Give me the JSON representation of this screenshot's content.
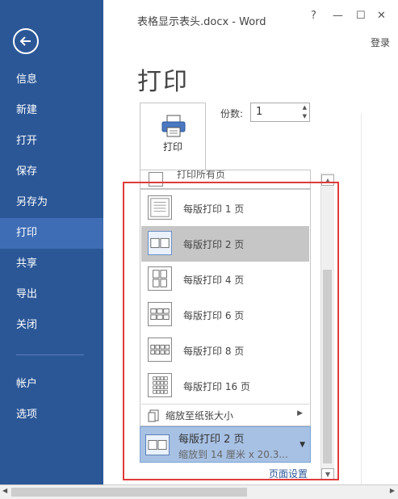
{
  "window": {
    "title": "表格显示表头.docx - Word",
    "help_label": "?",
    "minimize_label": "—",
    "restore_label": "☐",
    "close_label": "✕",
    "login_label": "登录"
  },
  "sidebar": {
    "items": [
      {
        "label": "信息"
      },
      {
        "label": "新建"
      },
      {
        "label": "打开"
      },
      {
        "label": "保存"
      },
      {
        "label": "另存为"
      },
      {
        "label": "打印"
      },
      {
        "label": "共享"
      },
      {
        "label": "导出"
      },
      {
        "label": "关闭"
      },
      {
        "label": "帐户"
      },
      {
        "label": "选项"
      }
    ],
    "active_item": "打印"
  },
  "print": {
    "title": "打印",
    "button_label": "打印",
    "copies_label": "份数:",
    "copies_value": "1",
    "settings_partial_text": "打印所有页",
    "page_setup_link": "页面设置"
  },
  "pages_per_sheet_menu": {
    "items": [
      {
        "label": "每版打印 1 页",
        "icon": "one-page-icon"
      },
      {
        "label": "每版打印 2 页",
        "icon": "two-pages-icon",
        "selected": true
      },
      {
        "label": "每版打印 4 页",
        "icon": "four-pages-icon"
      },
      {
        "label": "每版打印 6 页",
        "icon": "six-pages-icon"
      },
      {
        "label": "每版打印 8 页",
        "icon": "eight-pages-icon"
      },
      {
        "label": "每版打印 16 页",
        "icon": "sixteen-pages-icon"
      }
    ],
    "scale_to_paper_label": "缩放至纸张大小"
  },
  "current_selection": {
    "line1": "每版打印 2 页",
    "line2": "缩放到 14 厘米 x 20.3..."
  },
  "colors": {
    "sidebar": "#2b5797",
    "sidebar_active": "#3e6db5",
    "selection": "#a7c1e4",
    "highlight_frame": "#e03b3b"
  }
}
